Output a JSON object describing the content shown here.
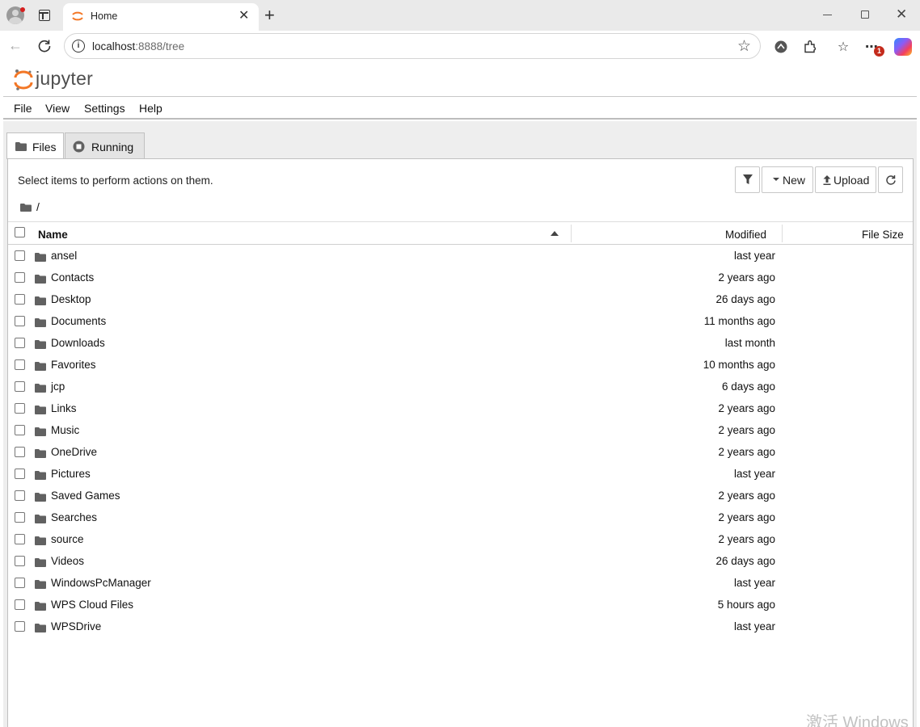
{
  "browser": {
    "tab_title": "Home",
    "url_host": "localhost",
    "url_rest": ":8888/tree",
    "notification_badge": "1"
  },
  "app": {
    "name": "jupyter"
  },
  "menu": [
    "File",
    "View",
    "Settings",
    "Help"
  ],
  "filetabs": {
    "files": "Files",
    "running": "Running"
  },
  "toolbar": {
    "hint": "Select items to perform actions on them.",
    "new_label": "New",
    "upload_label": "Upload"
  },
  "breadcrumb": "/",
  "columns": {
    "name": "Name",
    "modified": "Modified",
    "size": "File Size"
  },
  "rows": [
    {
      "name": "ansel",
      "modified": "last year"
    },
    {
      "name": "Contacts",
      "modified": "2 years ago"
    },
    {
      "name": "Desktop",
      "modified": "26 days ago"
    },
    {
      "name": "Documents",
      "modified": "11 months ago"
    },
    {
      "name": "Downloads",
      "modified": "last month"
    },
    {
      "name": "Favorites",
      "modified": "10 months ago"
    },
    {
      "name": "jcp",
      "modified": "6 days ago"
    },
    {
      "name": "Links",
      "modified": "2 years ago"
    },
    {
      "name": "Music",
      "modified": "2 years ago"
    },
    {
      "name": "OneDrive",
      "modified": "2 years ago"
    },
    {
      "name": "Pictures",
      "modified": "last year"
    },
    {
      "name": "Saved Games",
      "modified": "2 years ago"
    },
    {
      "name": "Searches",
      "modified": "2 years ago"
    },
    {
      "name": "source",
      "modified": "2 years ago"
    },
    {
      "name": "Videos",
      "modified": "26 days ago"
    },
    {
      "name": "WindowsPcManager",
      "modified": "last year"
    },
    {
      "name": "WPS Cloud Files",
      "modified": "5 hours ago"
    },
    {
      "name": "WPSDrive",
      "modified": "last year"
    }
  ],
  "watermark": "激活 Windows",
  "colors": {
    "jupyter_orange": "#f37726",
    "folder": "#616161"
  }
}
